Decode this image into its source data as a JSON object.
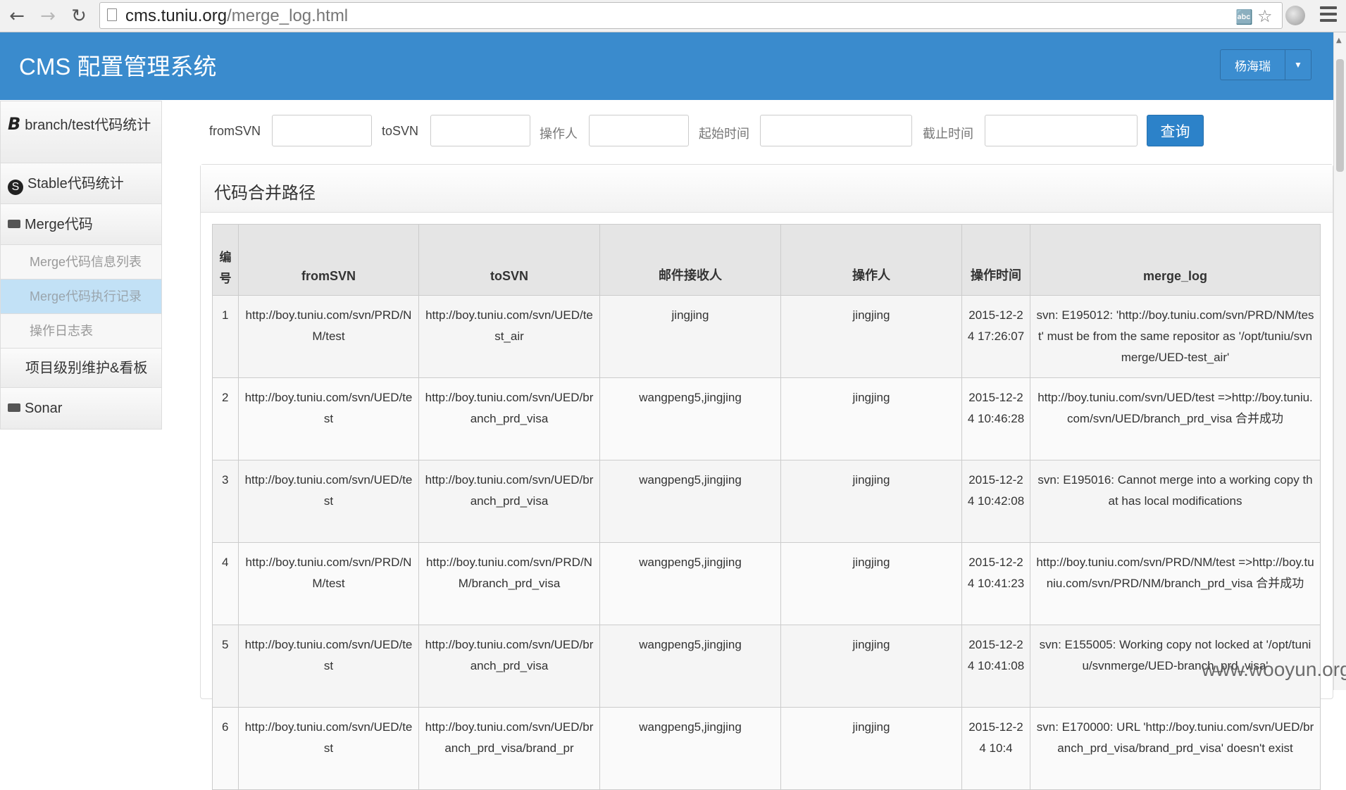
{
  "browser": {
    "url_host": "cms.tuniu.org",
    "url_path": "/merge_log.html"
  },
  "app": {
    "title": "CMS 配置管理系统",
    "user_name": "杨海瑞"
  },
  "sidebar": {
    "items": [
      {
        "label": "branch/test代码统计"
      },
      {
        "label": "Stable代码统计"
      },
      {
        "label": "Merge代码"
      },
      {
        "label": "Merge代码信息列表"
      },
      {
        "label": "Merge代码执行记录"
      },
      {
        "label": "操作日志表"
      },
      {
        "label": "项目级别维护&看板"
      },
      {
        "label": "Sonar"
      }
    ]
  },
  "filters": {
    "from_label": "fromSVN",
    "to_label": "toSVN",
    "operator_label": "操作人",
    "start_label": "起始时间",
    "end_label": "截止时间",
    "from_value": "",
    "to_value": "",
    "operator_value": "",
    "start_value": "",
    "end_value": "",
    "query_button": "查询"
  },
  "panel": {
    "title": "代码合并路径"
  },
  "table": {
    "headers": {
      "no": "编号",
      "from": "fromSVN",
      "to": "toSVN",
      "receiver": "邮件接收人",
      "operator": "操作人",
      "time": "操作时间",
      "log": "merge_log"
    },
    "rows": [
      {
        "no": "1",
        "from": "http://boy.tuniu.com/svn/PRD/NM/test",
        "to": "http://boy.tuniu.com/svn/UED/test_air",
        "receiver": "jingjing",
        "operator": "jingjing",
        "time": "2015-12-24 17:26:07",
        "log": "svn: E195012: 'http://boy.tuniu.com/svn/PRD/NM/test' must be from the same repositor as '/opt/tuniu/svnmerge/UED-test_air'"
      },
      {
        "no": "2",
        "from": "http://boy.tuniu.com/svn/UED/test",
        "to": "http://boy.tuniu.com/svn/UED/branch_prd_visa",
        "receiver": "wangpeng5,jingjing",
        "operator": "jingjing",
        "time": "2015-12-24 10:46:28",
        "log": "http://boy.tuniu.com/svn/UED/test =>http://boy.tuniu.com/svn/UED/branch_prd_visa 合并成功"
      },
      {
        "no": "3",
        "from": "http://boy.tuniu.com/svn/UED/test",
        "to": "http://boy.tuniu.com/svn/UED/branch_prd_visa",
        "receiver": "wangpeng5,jingjing",
        "operator": "jingjing",
        "time": "2015-12-24 10:42:08",
        "log": "svn: E195016: Cannot merge into a working copy that has local modifications"
      },
      {
        "no": "4",
        "from": "http://boy.tuniu.com/svn/PRD/NM/test",
        "to": "http://boy.tuniu.com/svn/PRD/NM/branch_prd_visa",
        "receiver": "wangpeng5,jingjing",
        "operator": "jingjing",
        "time": "2015-12-24 10:41:23",
        "log": "http://boy.tuniu.com/svn/PRD/NM/test =>http://boy.tuniu.com/svn/PRD/NM/branch_prd_visa 合并成功"
      },
      {
        "no": "5",
        "from": "http://boy.tuniu.com/svn/UED/test",
        "to": "http://boy.tuniu.com/svn/UED/branch_prd_visa",
        "receiver": "wangpeng5,jingjing",
        "operator": "jingjing",
        "time": "2015-12-24 10:41:08",
        "log": "svn: E155005: Working copy not locked at '/opt/tuniu/svnmerge/UED-branch_prd_visa'"
      },
      {
        "no": "6",
        "from": "http://boy.tuniu.com/svn/UED/test",
        "to": "http://boy.tuniu.com/svn/UED/branch_prd_visa/brand_pr",
        "receiver": "wangpeng5,jingjing",
        "operator": "jingjing",
        "time": "2015-12-24 10:4",
        "log": "svn: E170000: URL 'http://boy.tuniu.com/svn/UED/branch_prd_visa/brand_prd_visa' doesn't exist"
      }
    ]
  },
  "watermark": "www.wooyun.org"
}
